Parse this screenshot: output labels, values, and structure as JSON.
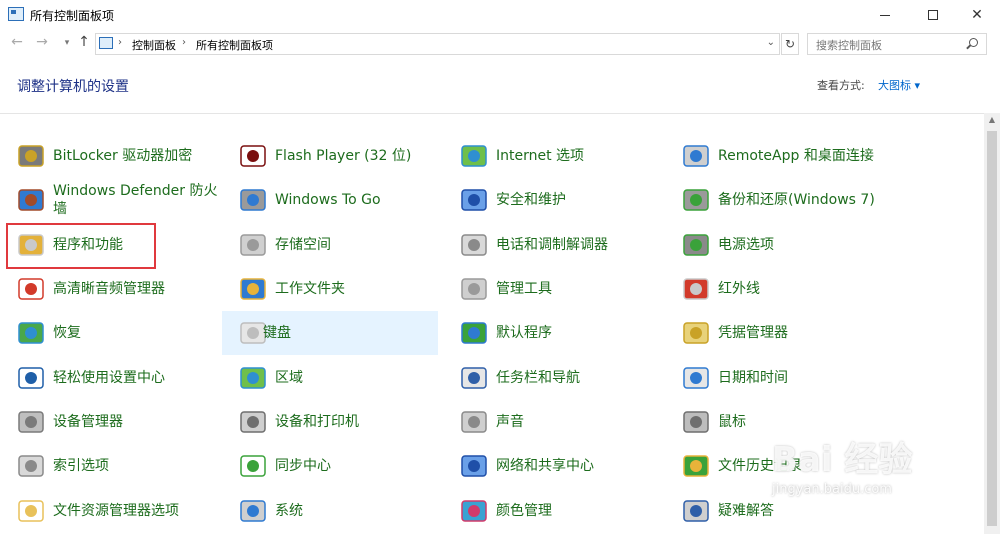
{
  "window": {
    "title": "所有控制面板项"
  },
  "nav": {
    "breadcrumbs": [
      "控制面板",
      "所有控制面板项"
    ],
    "search_placeholder": "搜索控制面板"
  },
  "header": {
    "title": "调整计算机的设置",
    "view_label": "查看方式:",
    "view_value": "大图标 ▾"
  },
  "items": [
    {
      "label": "BitLocker 驱动器加密",
      "icon": "bitlocker-icon",
      "col": 0,
      "row": 0
    },
    {
      "label": "Windows Defender 防火墙",
      "icon": "firewall-icon",
      "col": 0,
      "row": 1
    },
    {
      "label": "程序和功能",
      "icon": "programs-features-icon",
      "col": 0,
      "row": 2
    },
    {
      "label": "高清晰音频管理器",
      "icon": "audio-manager-icon",
      "col": 0,
      "row": 3
    },
    {
      "label": "恢复",
      "icon": "recovery-icon",
      "col": 0,
      "row": 4
    },
    {
      "label": "轻松使用设置中心",
      "icon": "ease-of-access-icon",
      "col": 0,
      "row": 5
    },
    {
      "label": "设备管理器",
      "icon": "device-manager-icon",
      "col": 0,
      "row": 6
    },
    {
      "label": "索引选项",
      "icon": "indexing-icon",
      "col": 0,
      "row": 7
    },
    {
      "label": "文件资源管理器选项",
      "icon": "explorer-options-icon",
      "col": 0,
      "row": 8
    },
    {
      "label": "Flash Player (32 位)",
      "icon": "flash-icon",
      "col": 1,
      "row": 0
    },
    {
      "label": "Windows To Go",
      "icon": "windows-to-go-icon",
      "col": 1,
      "row": 1
    },
    {
      "label": "存储空间",
      "icon": "storage-spaces-icon",
      "col": 1,
      "row": 2
    },
    {
      "label": "工作文件夹",
      "icon": "work-folders-icon",
      "col": 1,
      "row": 3
    },
    {
      "label": "键盘",
      "icon": "keyboard-icon",
      "col": 1,
      "row": 4
    },
    {
      "label": "区域",
      "icon": "region-icon",
      "col": 1,
      "row": 5
    },
    {
      "label": "设备和打印机",
      "icon": "printer-icon",
      "col": 1,
      "row": 6
    },
    {
      "label": "同步中心",
      "icon": "sync-icon",
      "col": 1,
      "row": 7
    },
    {
      "label": "系统",
      "icon": "system-icon",
      "col": 1,
      "row": 8
    },
    {
      "label": "Internet 选项",
      "icon": "internet-options-icon",
      "col": 2,
      "row": 0
    },
    {
      "label": "安全和维护",
      "icon": "security-flag-icon",
      "col": 2,
      "row": 1
    },
    {
      "label": "电话和调制解调器",
      "icon": "phone-modem-icon",
      "col": 2,
      "row": 2
    },
    {
      "label": "管理工具",
      "icon": "admin-tools-icon",
      "col": 2,
      "row": 3
    },
    {
      "label": "默认程序",
      "icon": "default-programs-icon",
      "col": 2,
      "row": 4
    },
    {
      "label": "任务栏和导航",
      "icon": "taskbar-icon",
      "col": 2,
      "row": 5
    },
    {
      "label": "声音",
      "icon": "sound-icon",
      "col": 2,
      "row": 6
    },
    {
      "label": "网络和共享中心",
      "icon": "network-icon",
      "col": 2,
      "row": 7
    },
    {
      "label": "颜色管理",
      "icon": "color-management-icon",
      "col": 2,
      "row": 8
    },
    {
      "label": "RemoteApp 和桌面连接",
      "icon": "remoteapp-icon",
      "col": 3,
      "row": 0
    },
    {
      "label": "备份和还原(Windows 7)",
      "icon": "backup-icon",
      "col": 3,
      "row": 1
    },
    {
      "label": "电源选项",
      "icon": "power-icon",
      "col": 3,
      "row": 2
    },
    {
      "label": "红外线",
      "icon": "infrared-icon",
      "col": 3,
      "row": 3
    },
    {
      "label": "凭据管理器",
      "icon": "credential-icon",
      "col": 3,
      "row": 4
    },
    {
      "label": "日期和时间",
      "icon": "date-time-icon",
      "col": 3,
      "row": 5
    },
    {
      "label": "鼠标",
      "icon": "mouse-icon",
      "col": 3,
      "row": 6
    },
    {
      "label": "文件历史记录",
      "icon": "file-history-icon",
      "col": 3,
      "row": 7
    },
    {
      "label": "疑难解答",
      "icon": "troubleshoot-icon",
      "col": 3,
      "row": 8
    }
  ],
  "hovered_item": "键盘",
  "highlighted_item": "程序和功能",
  "watermark": {
    "text": "Bai 经验",
    "sub": "jingyan.baidu.com"
  },
  "colors": {
    "link_green": "#1d6c1d",
    "title_blue": "#1e3287",
    "hover_bg": "#e5f3ff",
    "highlight_red": "#e0393e"
  }
}
